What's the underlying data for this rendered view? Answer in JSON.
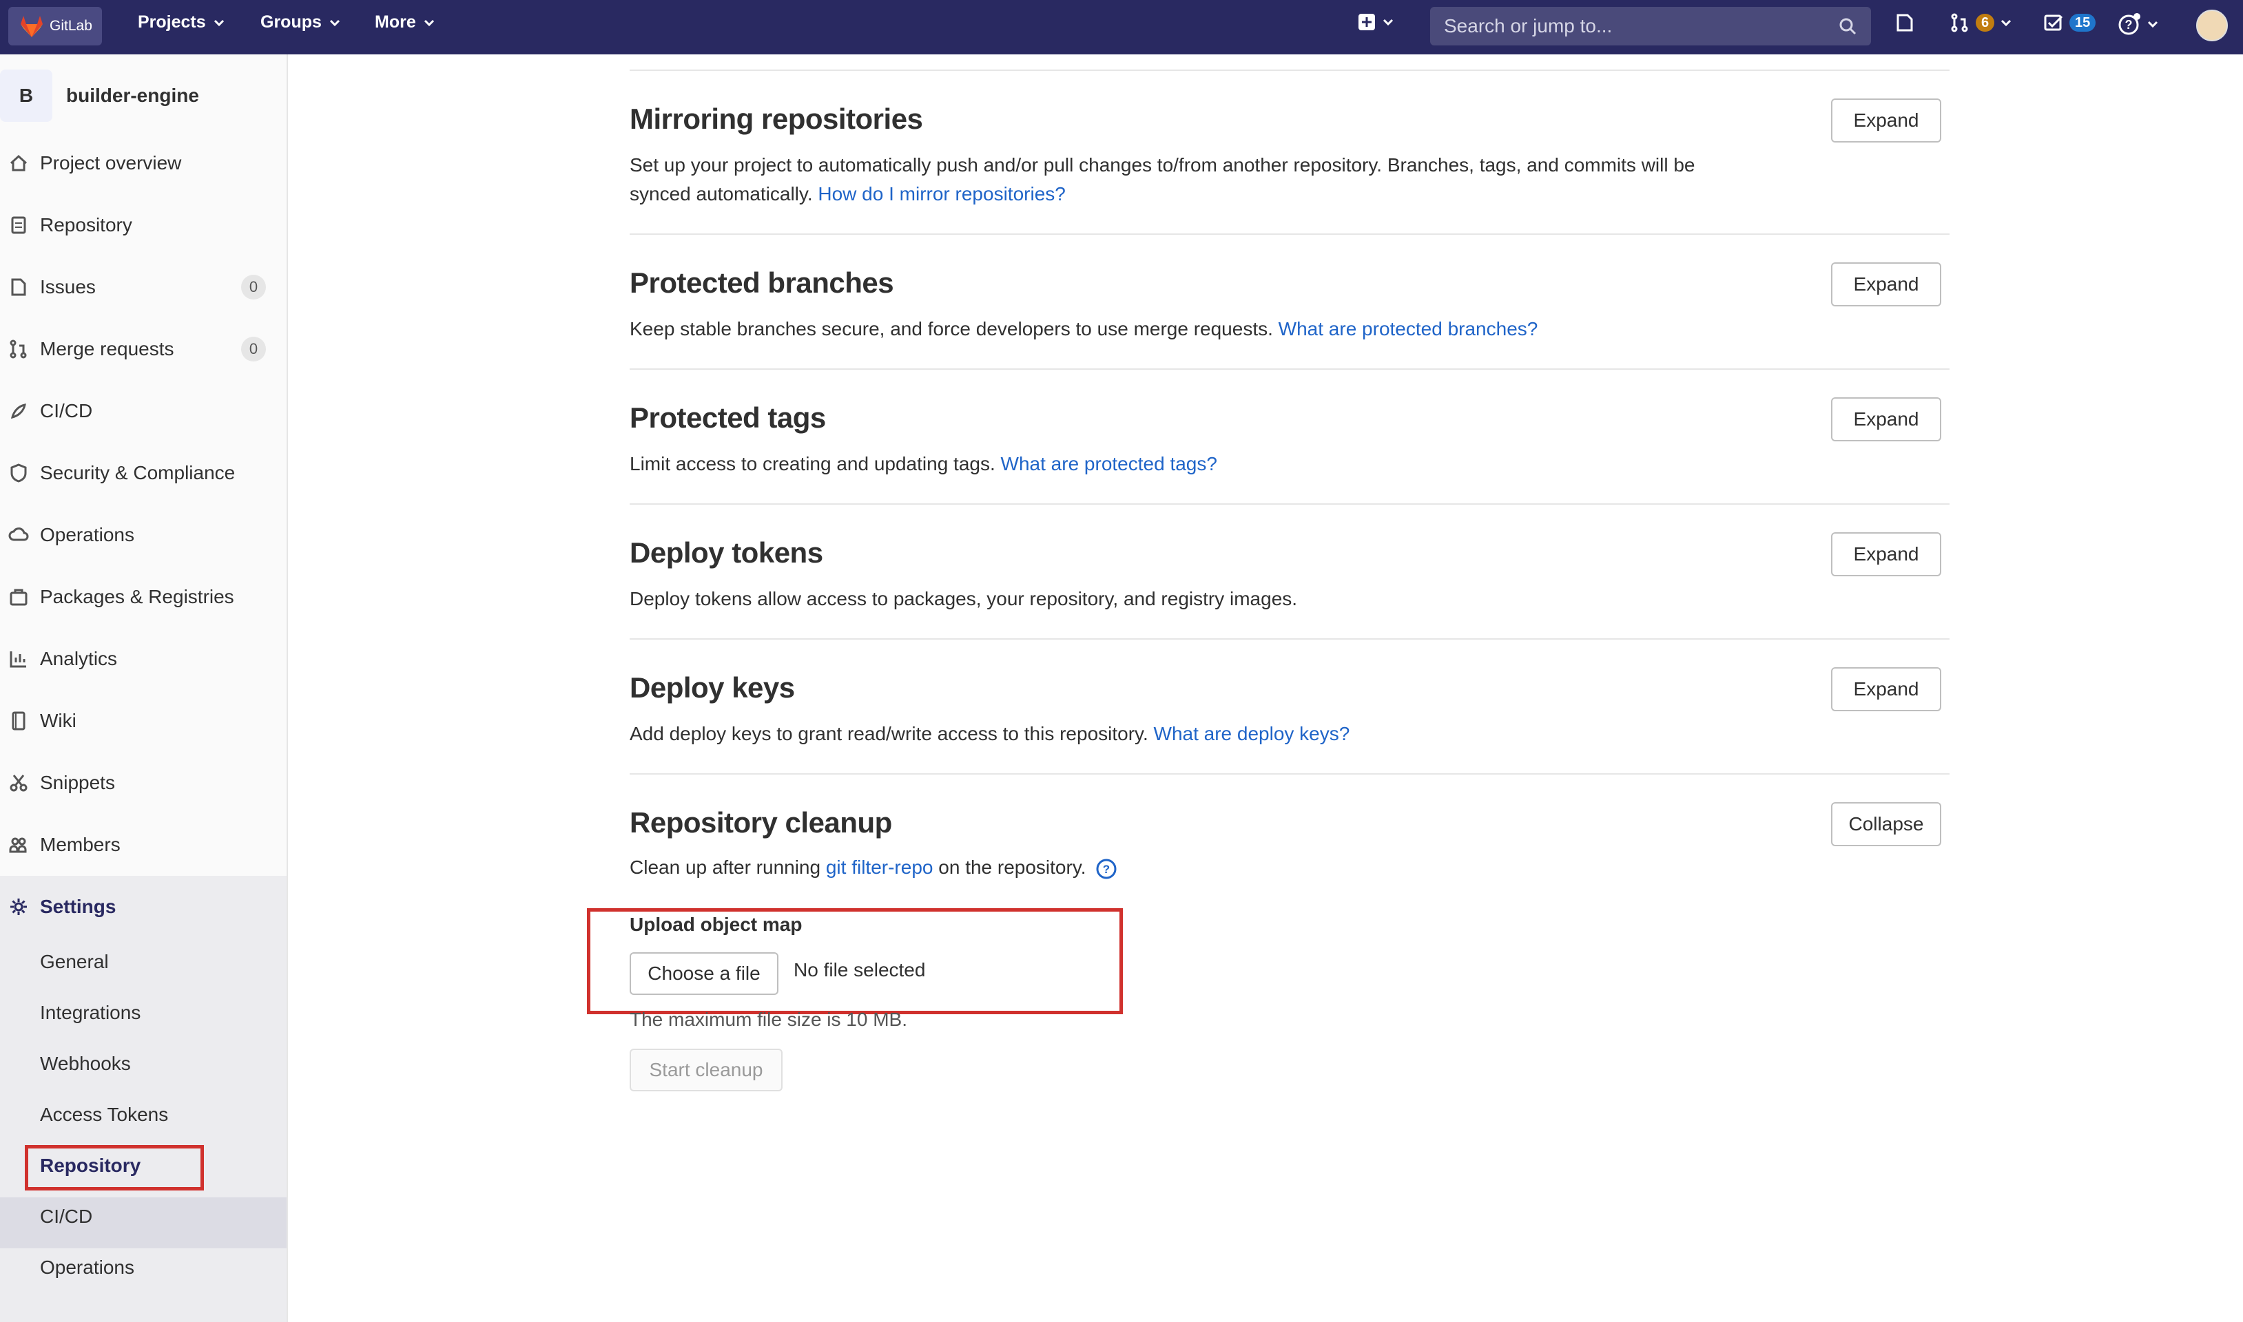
{
  "topbar": {
    "logo_text": "GitLab",
    "nav": [
      {
        "label": "Projects"
      },
      {
        "label": "Groups"
      },
      {
        "label": "More"
      }
    ],
    "search_placeholder": "Search or jump to...",
    "merge_requests_count": "6",
    "todos_count": "15"
  },
  "sidebar": {
    "project_initial": "B",
    "project_name": "builder-engine",
    "items": [
      {
        "label": "Project overview",
        "icon": "home-icon"
      },
      {
        "label": "Repository",
        "icon": "doc-icon"
      },
      {
        "label": "Issues",
        "icon": "issues-icon",
        "count": "0"
      },
      {
        "label": "Merge requests",
        "icon": "merge-request-icon",
        "count": "0"
      },
      {
        "label": "CI/CD",
        "icon": "rocket-icon"
      },
      {
        "label": "Security & Compliance",
        "icon": "shield-icon"
      },
      {
        "label": "Operations",
        "icon": "cloud-gear-icon"
      },
      {
        "label": "Packages & Registries",
        "icon": "package-icon"
      },
      {
        "label": "Analytics",
        "icon": "chart-icon"
      },
      {
        "label": "Wiki",
        "icon": "book-icon"
      },
      {
        "label": "Snippets",
        "icon": "scissors-icon"
      },
      {
        "label": "Members",
        "icon": "users-icon"
      },
      {
        "label": "Settings",
        "icon": "gear-icon"
      }
    ],
    "settings_sub": [
      {
        "label": "General"
      },
      {
        "label": "Integrations"
      },
      {
        "label": "Webhooks"
      },
      {
        "label": "Access Tokens"
      },
      {
        "label": "Repository"
      },
      {
        "label": "CI/CD"
      },
      {
        "label": "Operations"
      }
    ]
  },
  "sections": [
    {
      "title": "Mirroring repositories",
      "desc": "Set up your project to automatically push and/or pull changes to/from another repository. Branches, tags, and commits will be synced automatically.",
      "link": "How do I mirror repositories?",
      "button": "Expand"
    },
    {
      "title": "Protected branches",
      "desc": "Keep stable branches secure, and force developers to use merge requests.",
      "link": "What are protected branches?",
      "button": "Expand"
    },
    {
      "title": "Protected tags",
      "desc": "Limit access to creating and updating tags.",
      "link": "What are protected tags?",
      "button": "Expand"
    },
    {
      "title": "Deploy tokens",
      "desc": "Deploy tokens allow access to packages, your repository, and registry images.",
      "link": "",
      "button": "Expand"
    },
    {
      "title": "Deploy keys",
      "desc": "Add deploy keys to grant read/write access to this repository.",
      "link": "What are deploy keys?",
      "button": "Expand"
    }
  ],
  "cleanup": {
    "title": "Repository cleanup",
    "desc_before": "Clean up after running",
    "link": "git filter-repo",
    "desc_after": "on the repository.",
    "button": "Collapse",
    "upload_label": "Upload object map",
    "choose_button": "Choose a file",
    "file_status": "No file selected",
    "file_note": "The maximum file size is 10 MB.",
    "start_button": "Start cleanup"
  },
  "colors": {
    "topbar": "#292961",
    "link": "#1f64c8",
    "highlight_box": "#d0312d"
  }
}
